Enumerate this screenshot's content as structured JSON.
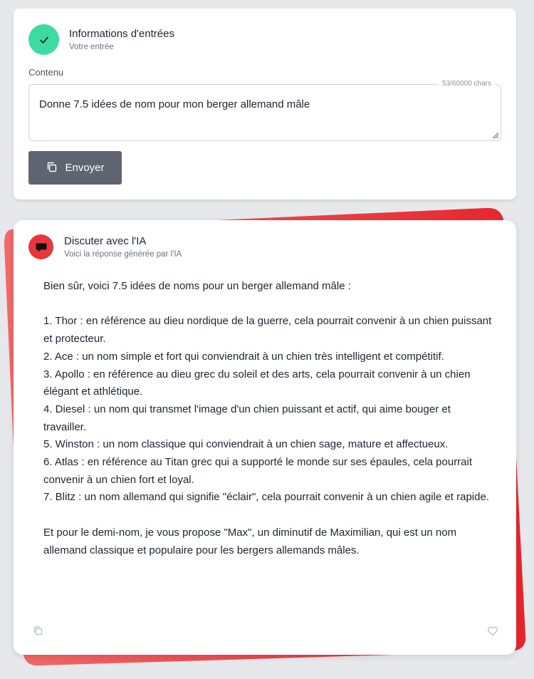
{
  "input_card": {
    "title": "Informations d'entrées",
    "subtitle": "Votre entrée",
    "field_label": "Contenu",
    "char_count": "53/60000 chars",
    "input_value": "Donne 7.5 idées de nom pour mon berger allemand mâle",
    "send_label": "Envoyer",
    "icon": "check-icon",
    "accent_color": "#3ddba2"
  },
  "ai_card": {
    "title": "Discuter avec l'IA",
    "subtitle": "Voici la réponse générée par l'IA",
    "icon": "chat-bubble-icon",
    "accent_color": "#e8363b",
    "response_lines": [
      "Bien sûr, voici 7.5 idées de noms pour un berger allemand mâle :",
      "",
      "1. Thor : en référence au dieu nordique de la guerre, cela pourrait convenir à un chien puissant et protecteur.",
      "2. Ace : un nom simple et fort qui conviendrait à un chien très intelligent et compétitif.",
      "3. Apollo : en référence au dieu grec du soleil et des arts, cela pourrait convenir à un chien élégant et athlétique.",
      "4. Diesel : un nom qui transmet l'image d'un chien puissant et actif, qui aime bouger et travailler.",
      "5. Winston : un nom classique qui conviendrait à un chien sage, mature et affectueux.",
      "6. Atlas : en référence au Titan grec qui a supporté le monde sur ses épaules, cela pourrait convenir à un chien fort et loyal.",
      "7. Blitz : un nom allemand qui signifie \"éclair\", cela pourrait convenir à un chien agile et rapide.",
      "",
      "Et pour le demi-nom, je vous propose \"Max\", un diminutif de Maximilian, qui est un nom allemand classique et populaire pour les bergers allemands mâles."
    ],
    "footer_icons": [
      "copy-icon",
      "heart-icon"
    ]
  }
}
